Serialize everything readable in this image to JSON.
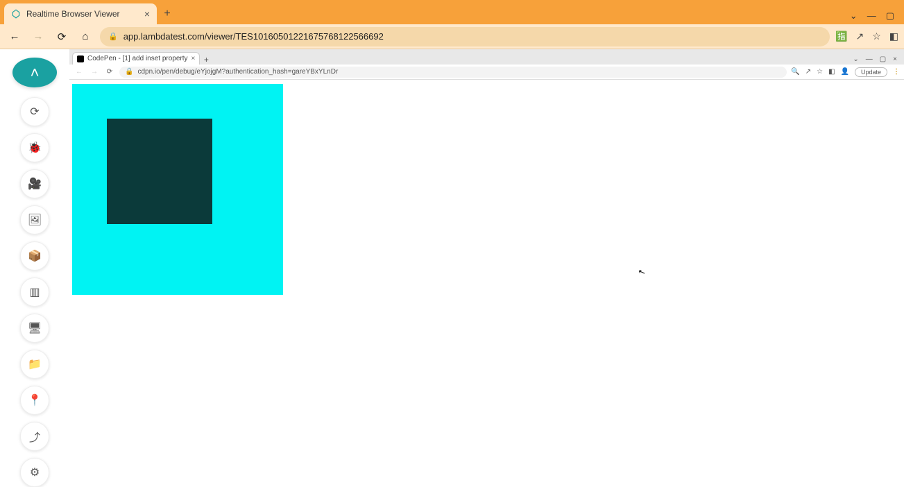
{
  "outer": {
    "tab_title": "Realtime Browser Viewer",
    "url": "app.lambdatest.com/viewer/TES10160501221675768122566692",
    "window_controls": {
      "chevron": "⌄",
      "min": "—",
      "max": "▢"
    }
  },
  "sidebar": {
    "main": "collapse",
    "tools": [
      {
        "name": "switch-icon",
        "glyph": "⟳"
      },
      {
        "name": "bug-icon",
        "glyph": "🐞"
      },
      {
        "name": "video-icon",
        "glyph": "🎥"
      },
      {
        "name": "gallery-icon",
        "glyph": "🖼"
      },
      {
        "name": "box-icon",
        "glyph": "📦"
      },
      {
        "name": "layout-icon",
        "glyph": "▥"
      },
      {
        "name": "monitor-icon",
        "glyph": "🖥"
      },
      {
        "name": "folder-icon",
        "glyph": "📁"
      },
      {
        "name": "location-icon",
        "glyph": "📍"
      },
      {
        "name": "upload-icon",
        "glyph": "⤴"
      },
      {
        "name": "gear-icon",
        "glyph": "⚙"
      }
    ]
  },
  "inner": {
    "tab_title": "CodePen - [1] add inset property",
    "url": "cdpn.io/pen/debug/eYjojgM?authentication_hash=gareYBxYLnDr",
    "update_label": "Update"
  }
}
